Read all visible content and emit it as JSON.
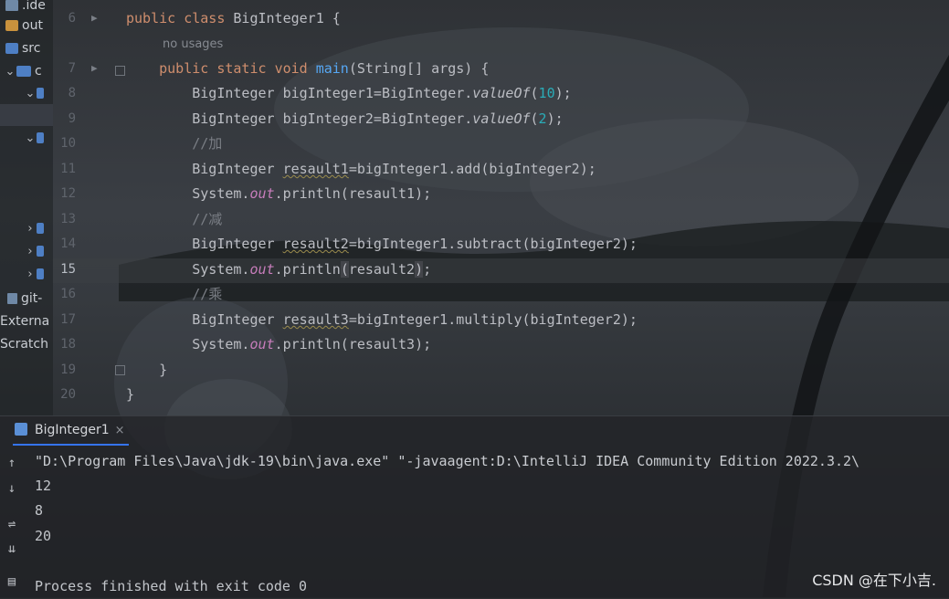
{
  "project_tree": {
    "items": [
      {
        "label": ".ide"
      },
      {
        "label": "out"
      },
      {
        "label": "src"
      },
      {
        "label": "c"
      },
      {
        "label": ""
      },
      {
        "label": ""
      },
      {
        "label": ""
      },
      {
        "label": ""
      },
      {
        "label": ""
      },
      {
        "label": "git-"
      },
      {
        "label": "Externa"
      },
      {
        "label": "Scratch"
      }
    ]
  },
  "editor": {
    "line_numbers": [
      "6",
      "7",
      "8",
      "9",
      "10",
      "11",
      "12",
      "13",
      "14",
      "15",
      "16",
      "17",
      "18",
      "19",
      "20"
    ],
    "active_line": "15",
    "usage_hint": "no usages",
    "lines": {
      "l6_kw1": "public",
      "l6_kw2": "class",
      "l6_name": "BigInteger1",
      "l6_brace": "{",
      "l7_kw1": "public",
      "l7_kw2": "static",
      "l7_kw3": "void",
      "l7_fn": "main",
      "l7_rest": "(String[] args) {",
      "l8_a": "BigInteger bigInteger1=BigInteger.",
      "l8_m": "valueOf",
      "l8_p1": "(",
      "l8_n": "10",
      "l8_p2": ");",
      "l9_a": "BigInteger bigInteger2=BigInteger.",
      "l9_m": "valueOf",
      "l9_p1": "(",
      "l9_n": "2",
      "l9_p2": ");",
      "l10_cmt": "//加",
      "l11_a": "BigInteger ",
      "l11_v": "resault1",
      "l11_b": "=bigInteger1.add(bigInteger2);",
      "l12_a": "System.",
      "l12_f": "out",
      "l12_b": ".println(resault1);",
      "l13_cmt": "//减",
      "l14_a": "BigInteger ",
      "l14_v": "resault2",
      "l14_b": "=bigInteger1.subtract(bigInteger2);",
      "l15_a": "System.",
      "l15_f": "out",
      "l15_b": ".println",
      "l15_p1": "(",
      "l15_c": "resault2",
      "l15_p2": ")",
      "l15_d": ";",
      "l16_cmt": "//乘",
      "l17_a": "BigInteger ",
      "l17_v": "resault3",
      "l17_b": "=bigInteger1.multiply(bigInteger2);",
      "l18_a": "System.",
      "l18_f": "out",
      "l18_b": ".println(resault3);",
      "l19": "}",
      "l20": "}"
    }
  },
  "run_panel": {
    "tab_label": "BigInteger1",
    "tab_close": "×",
    "console": {
      "command": "\"D:\\Program Files\\Java\\jdk-19\\bin\\java.exe\" \"-javaagent:D:\\IntelliJ IDEA Community Edition 2022.3.2\\",
      "outputs": [
        "12",
        "8",
        "20"
      ],
      "finish": "Process finished with exit code 0"
    }
  },
  "watermark": "CSDN @在下小吉."
}
